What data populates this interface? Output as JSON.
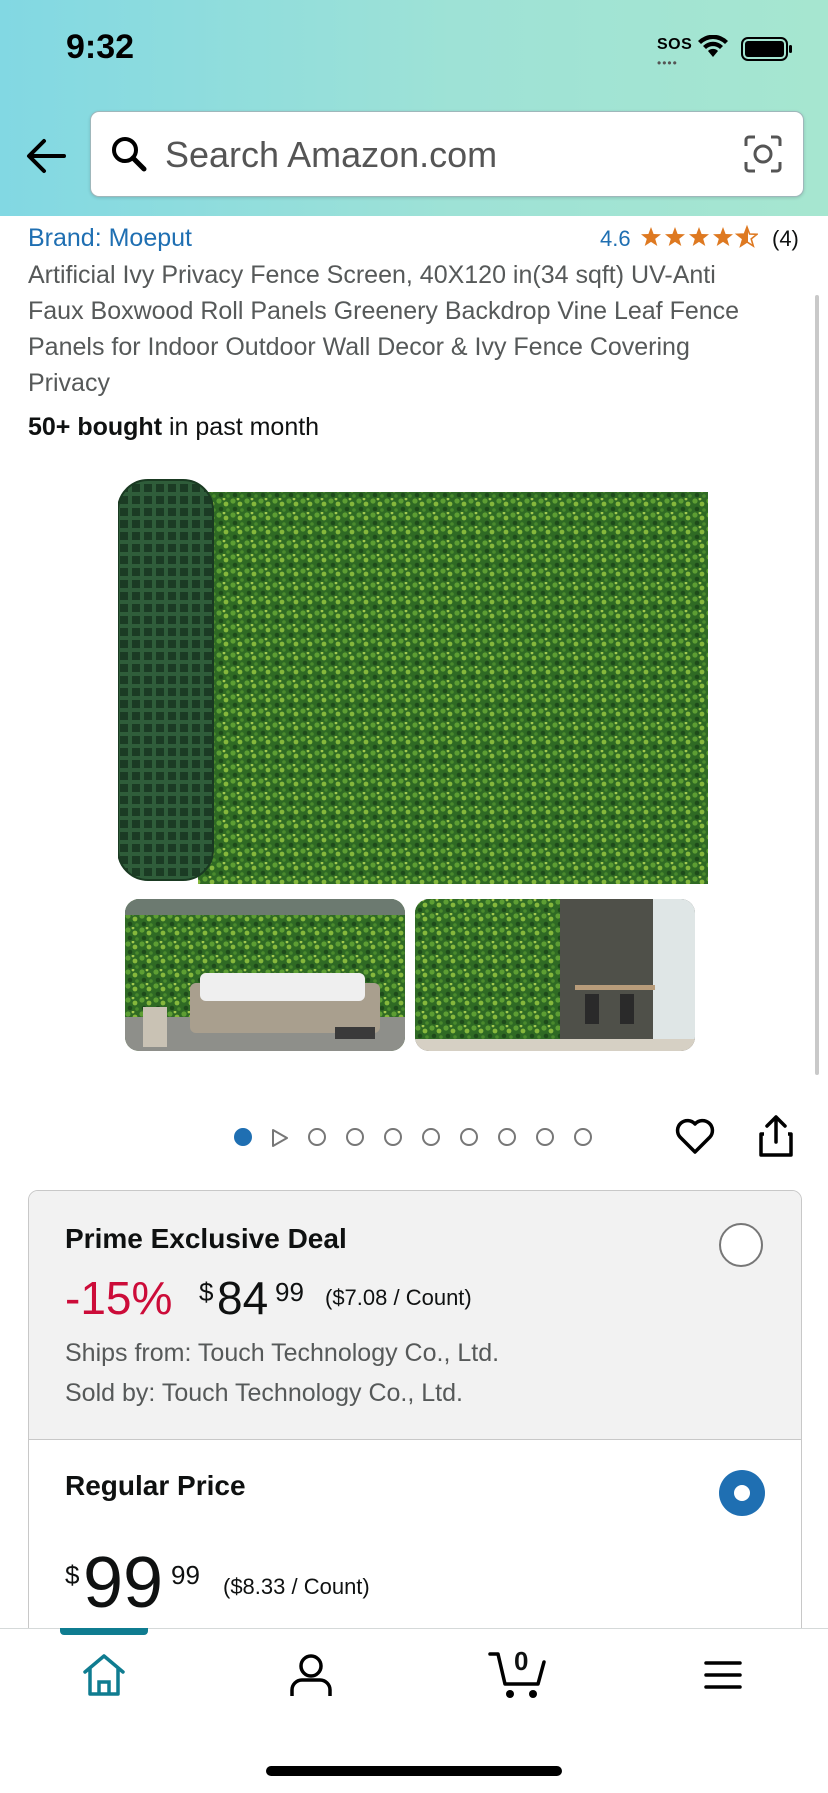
{
  "status_bar": {
    "time": "9:32",
    "sos": "SOS"
  },
  "header": {
    "search_placeholder": "Search Amazon.com"
  },
  "product": {
    "brand": "Brand: Moeput",
    "rating": "4.6",
    "rating_value": 4.6,
    "review_count": "(4)",
    "title": "Artificial Ivy Privacy Fence Screen, 40X120 in(34 sqft) UV-Anti Faux Boxwood Roll Panels Greenery Backdrop Vine Leaf Fence Panels for Indoor Outdoor Wall Decor & Ivy Fence Covering Privacy",
    "bought_bold": "50+ bought",
    "bought_rest": " in past month"
  },
  "carousel": {
    "total_dots": 10,
    "active_index": 0,
    "video_index": 1
  },
  "offers": {
    "deal": {
      "title": "Prime Exclusive Deal",
      "discount": "-15%",
      "currency": "$",
      "price_whole": "84",
      "price_fraction": "99",
      "unit_price": "($7.08 / Count)",
      "ships_from": "Ships from: Touch Technology Co., Ltd.",
      "sold_by": "Sold by: Touch Technology Co., Ltd.",
      "selected": false
    },
    "regular": {
      "title": "Regular Price",
      "currency": "$",
      "price_whole": "99",
      "price_fraction": "99",
      "unit_price": "($8.33 / Count)",
      "selected": true
    }
  },
  "bottom_nav": {
    "cart_count": "0",
    "active": "home"
  },
  "colors": {
    "link": "#1f6fb2",
    "deal_red": "#cc0c39",
    "accent_teal": "#0f7c90",
    "star": "#de7921"
  }
}
